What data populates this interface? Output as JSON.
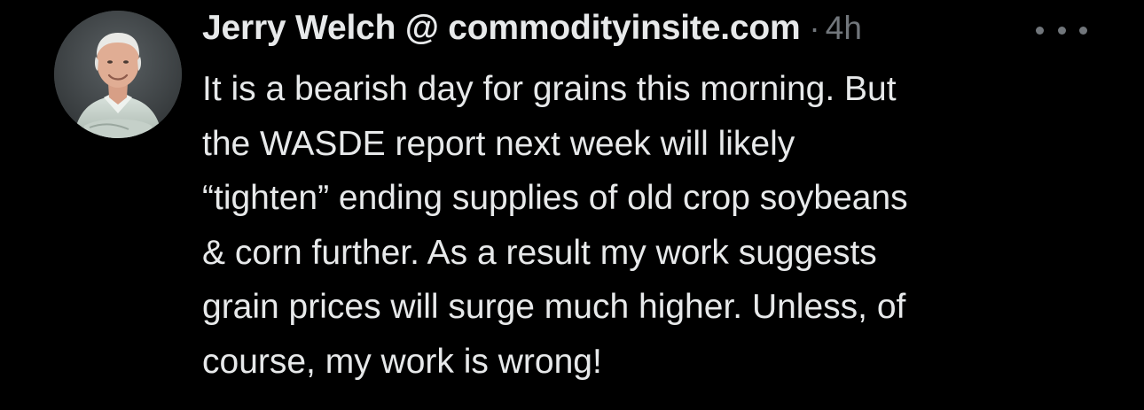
{
  "tweet": {
    "author": "Jerry Welch @ commodityinsite.com",
    "separator": "·",
    "timestamp": "4h",
    "lines": [
      "It is a bearish day for grains this morning. But",
      "the WASDE report next week will likely",
      "“tighten” ending supplies of old crop soybeans",
      "& corn further. As a result my work suggests",
      "grain prices will surge much higher. Unless, of",
      "course, my work is wrong!"
    ]
  },
  "icons": {
    "more": "more-horizontal-icon",
    "avatar": "profile-photo"
  },
  "colors": {
    "background": "#000000",
    "primary_text": "#e7e9ea",
    "secondary_text": "#71767b"
  }
}
